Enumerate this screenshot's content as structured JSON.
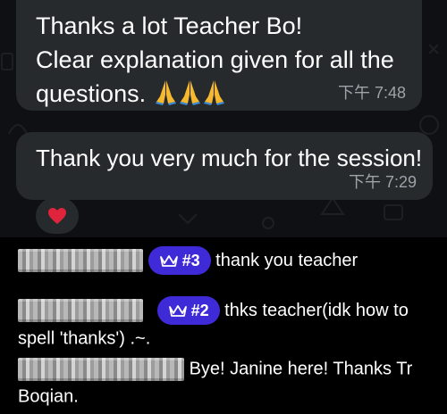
{
  "messages": [
    {
      "lines": [
        "Thanks a lot Teacher Bo!",
        "Clear explanation given for all the",
        "questions."
      ],
      "emoji_count": 3,
      "time": "下午 7:48"
    },
    {
      "text": "Thank you very much for the session!",
      "time": "下午 7:29"
    }
  ],
  "reaction": {
    "emoji": "heart-icon"
  },
  "comments": [
    {
      "rank": "#3",
      "text": "thank you teacher"
    },
    {
      "rank": "#2",
      "text": "thks teacher(idk how to spell 'thanks') .~."
    },
    {
      "text": "Bye! Janine here! Thanks Tr Boqian."
    }
  ],
  "colors": {
    "bubble": "#262a2d",
    "badge": "#3f2ad8",
    "background": "#0f1013",
    "timestamp": "#9da3a8"
  }
}
